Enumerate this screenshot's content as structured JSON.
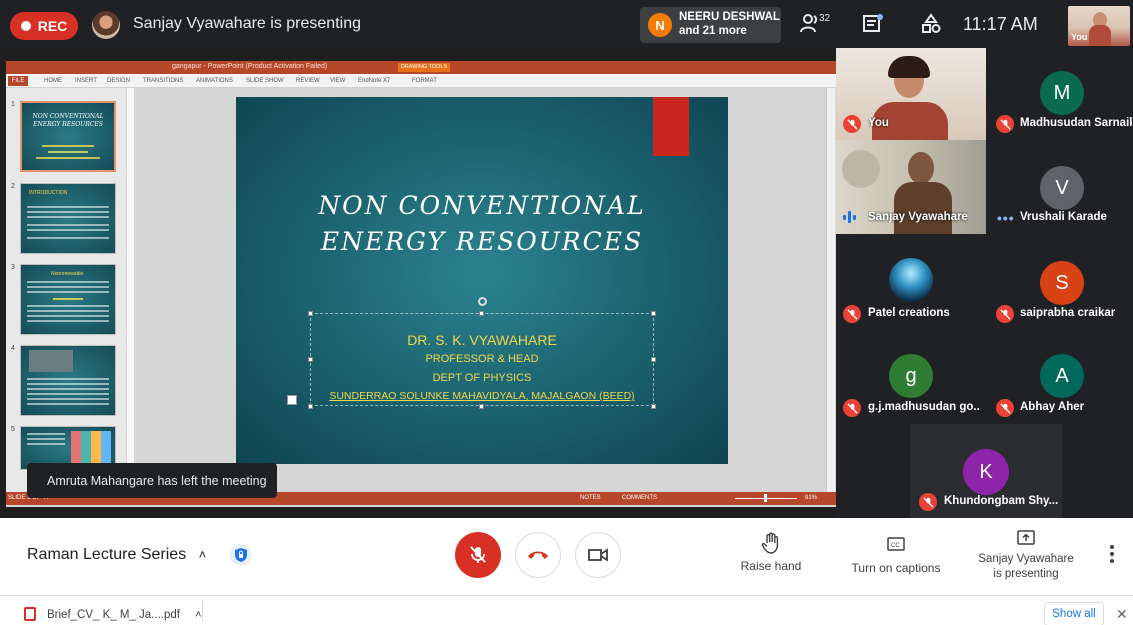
{
  "top_bar": {
    "rec_label": "REC",
    "presenting_title": "Sanjay Vyawahare is presenting",
    "participant_notice": {
      "initial": "N",
      "line1": "NEERU DESHWAL",
      "line2": "and 21 more"
    },
    "people_count": "32",
    "time": "11:17 AM",
    "self_label": "You"
  },
  "powerpoint": {
    "window_title": "gangapur - PowerPoint (Product Activation Failed)",
    "drawing_tools": "DRAWING TOOLS",
    "ribbon_tabs": [
      "FILE",
      "HOME",
      "INSERT",
      "DESIGN",
      "TRANSITIONS",
      "ANIMATIONS",
      "SLIDE SHOW",
      "REVIEW",
      "VIEW",
      "EndNote X7",
      "FORMAT"
    ],
    "status_left": "SLIDE 1 OF 44",
    "status_notes": "NOTES",
    "status_comments": "COMMENTS",
    "zoom": "91%",
    "thumbnails": [
      {
        "num": "1",
        "title": "NON CONVENTIONAL ENERGY RESOURCES"
      },
      {
        "num": "2",
        "title": "INTRODUCTION"
      },
      {
        "num": "3",
        "title": "Nonrenewable"
      },
      {
        "num": "4",
        "title": ""
      },
      {
        "num": "5",
        "title": ""
      }
    ],
    "slide": {
      "title_line1": "NON CONVENTIONAL",
      "title_line2": "ENERGY RESOURCES",
      "author_name": "DR. S. K. VYAWAHARE",
      "role": "PROFESSOR & HEAD",
      "dept": "DEPT OF PHYSICS",
      "college": "SUNDERRAO SOLUNKE MAHAVIDYALA, MAJALGAON (BEED)"
    }
  },
  "toast": "Amruta Mahangare has left the meeting",
  "participants": [
    {
      "name": "You",
      "type": "video",
      "muted": true
    },
    {
      "name": "Madhusudan Sarnaik",
      "initial": "M",
      "color": "#0b6b4f",
      "muted": true
    },
    {
      "name": "Sanjay Vyawahare",
      "type": "video",
      "speaking": true
    },
    {
      "name": "Vrushali Karade",
      "initial": "V",
      "color": "#5f6368",
      "muted": false
    },
    {
      "name": "Patel creations",
      "type": "image",
      "muted": true
    },
    {
      "name": "saiprabha craikar",
      "initial": "S",
      "color": "#d84315",
      "muted": true
    },
    {
      "name": "g.j.madhusudan go...",
      "initial": "g",
      "color": "#2e7d32",
      "muted": true
    },
    {
      "name": "Abhay Aher",
      "initial": "A",
      "color": "#00695c",
      "muted": true
    },
    {
      "name": "Khundongbam Shy...",
      "initial": "K",
      "color": "#8e24aa",
      "muted": true
    }
  ],
  "bottom_bar": {
    "meeting_name": "Raman Lecture Series",
    "raise_hand": "Raise hand",
    "captions": "Turn on captions",
    "presenting_line1": "Sanjay Vyawahare",
    "presenting_line2": "is presenting"
  },
  "downloads": {
    "file_name": "Brief_CV_ K_ M_ Ja....pdf",
    "show_all": "Show all"
  }
}
